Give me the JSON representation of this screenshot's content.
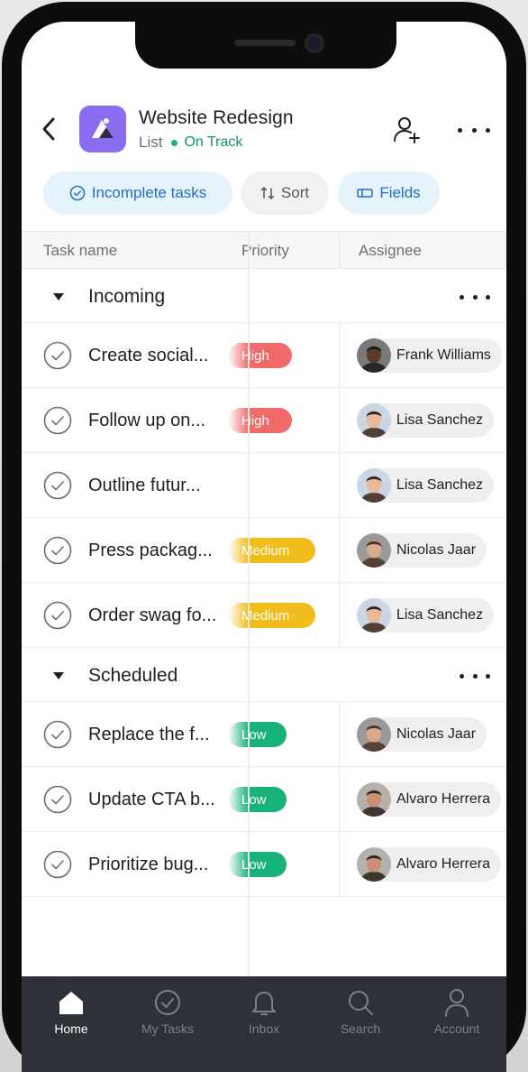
{
  "header": {
    "project_title": "Website Redesign",
    "view_label": "List",
    "status": "On Track",
    "status_color": "#13935f",
    "project_icon_color": "#8a6cf0"
  },
  "filters": {
    "incomplete": "Incomplete tasks",
    "sort": "Sort",
    "fields": "Fields"
  },
  "columns": {
    "task_name": "Task name",
    "priority": "Priority",
    "assignee": "Assignee"
  },
  "sections": [
    {
      "title": "Incoming",
      "tasks": [
        {
          "name": "Create social...",
          "priority": "High",
          "assignee": "Frank Williams"
        },
        {
          "name": "Follow up on...",
          "priority": "High",
          "assignee": "Lisa Sanchez"
        },
        {
          "name": "Outline futur...",
          "priority": "",
          "assignee": "Lisa Sanchez"
        },
        {
          "name": "Press packag...",
          "priority": "Medium",
          "assignee": "Nicolas Jaar"
        },
        {
          "name": "Order swag fo...",
          "priority": "Medium",
          "assignee": "Lisa Sanchez"
        }
      ]
    },
    {
      "title": "Scheduled",
      "tasks": [
        {
          "name": "Replace the f...",
          "priority": "Low",
          "assignee": "Nicolas Jaar"
        },
        {
          "name": "Update CTA b...",
          "priority": "Low",
          "assignee": "Alvaro Herrera"
        },
        {
          "name": "Prioritize bug...",
          "priority": "Low",
          "assignee": "Alvaro Herrera"
        }
      ]
    }
  ],
  "priority_colors": {
    "High": "#f06a6a",
    "Medium": "#f1bd1c",
    "Low": "#19b37a"
  },
  "tabbar": {
    "home": "Home",
    "my_tasks": "My Tasks",
    "inbox": "Inbox",
    "search": "Search",
    "account": "Account"
  }
}
